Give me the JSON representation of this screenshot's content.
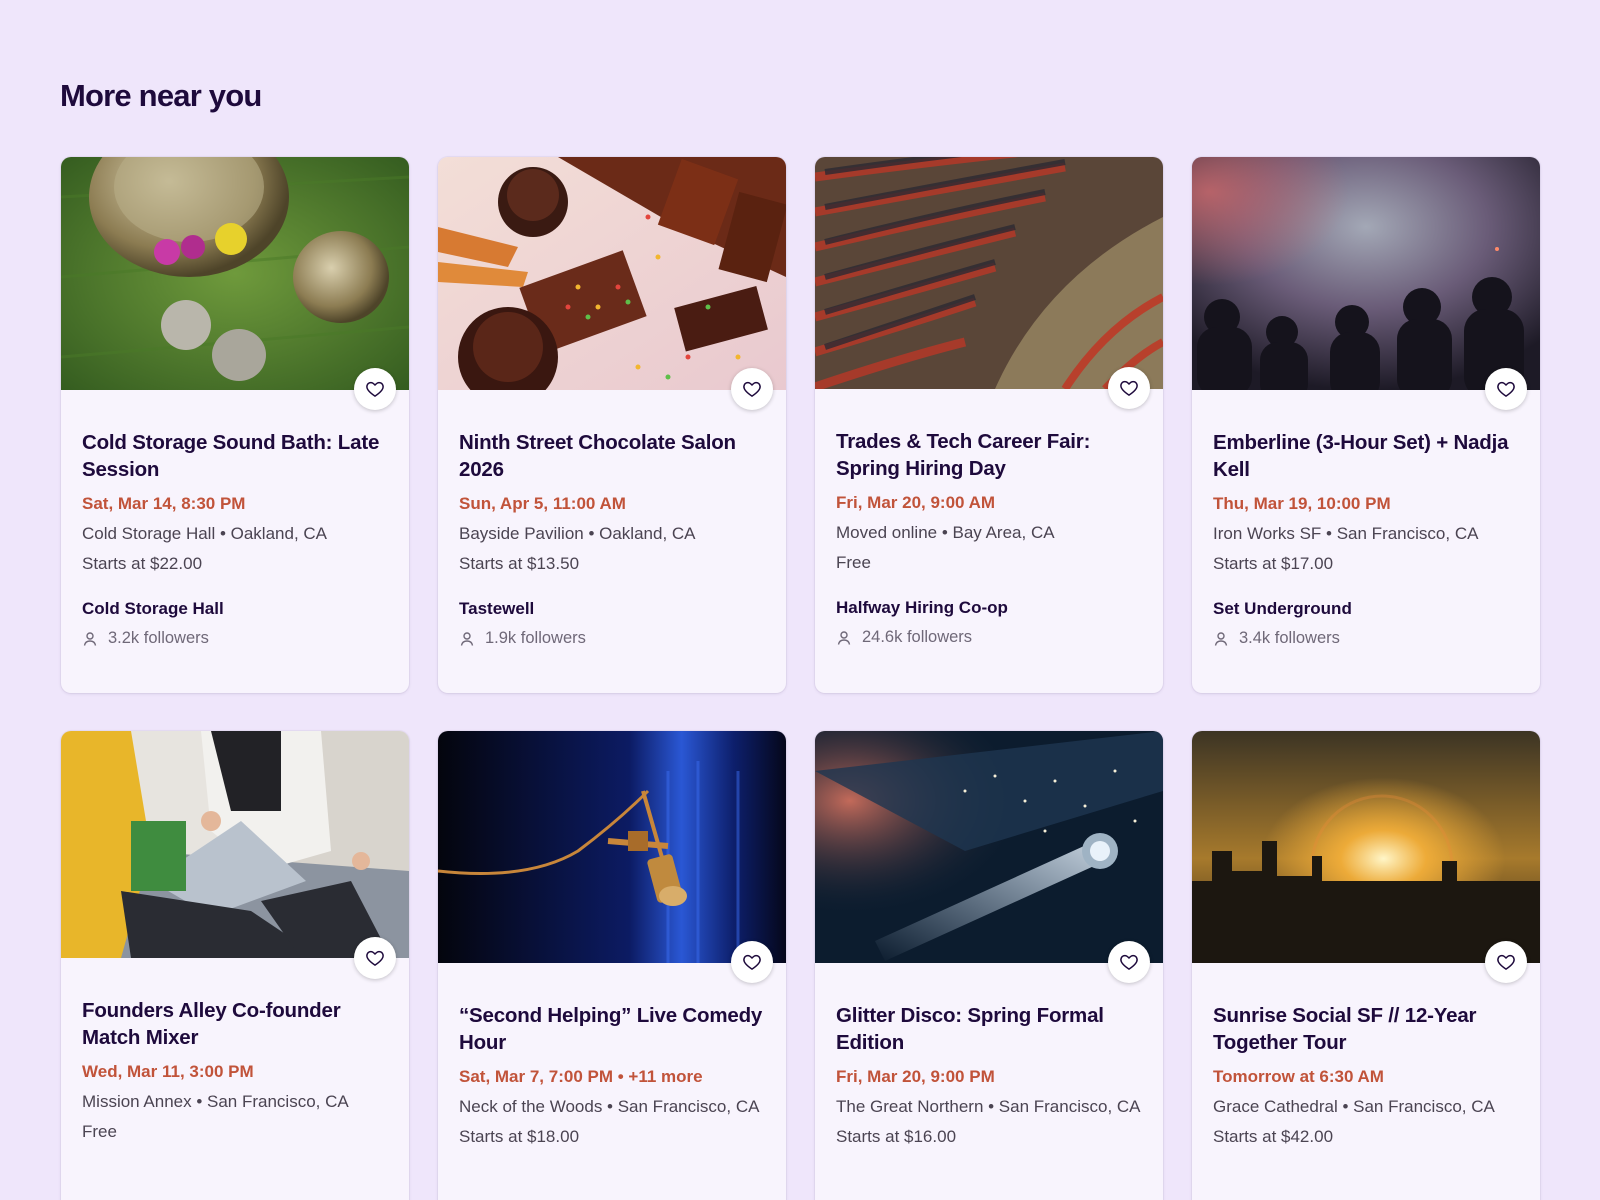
{
  "section": {
    "title": "More near you"
  },
  "events": [
    {
      "title": "Cold Storage Sound Bath: Late Session",
      "date": "Sat, Mar 14, 8:30 PM",
      "location": "Cold Storage Hall • Oakland, CA",
      "price": "Starts at $22.00",
      "organizer": "Cold Storage Hall",
      "followers": "3.2k followers",
      "image": "singing-bowls-on-grass"
    },
    {
      "title": "Ninth Street Chocolate Salon 2026",
      "date": "Sun, Apr 5, 11:00 AM",
      "location": "Bayside Pavilion • Oakland, CA",
      "price": "Starts at $13.50",
      "organizer": "Tastewell",
      "followers": "1.9k followers",
      "image": "chocolates-with-sprinkles"
    },
    {
      "title": "Trades & Tech Career Fair: Spring Hiring Day",
      "date": "Fri, Mar 20, 9:00 AM",
      "location": "Moved online • Bay Area, CA",
      "price": "Free",
      "organizer": "Halfway Hiring Co-op",
      "followers": "24.6k followers",
      "image": "auditorium-audience"
    },
    {
      "title": "Emberline (3-Hour Set) + Nadja Kell",
      "date": "Thu, Mar 19, 10:00 PM",
      "location": "Iron Works SF • San Francisco, CA",
      "price": "Starts at $17.00",
      "organizer": "Set Underground",
      "followers": "3.4k followers",
      "image": "concert-crowd-haze"
    },
    {
      "title": "Founders Alley Co-founder Match Mixer",
      "date": "Wed, Mar 11, 3:00 PM",
      "location": "Mission Annex • San Francisco, CA",
      "price": "Free",
      "image": "people-with-laptop"
    },
    {
      "title": "“Second Helping” Live Comedy Hour",
      "date": "Sat, Mar 7, 7:00 PM • +11 more",
      "location": "Neck of the Woods • San Francisco, CA",
      "price": "Starts at $18.00",
      "image": "microphone-blue-curtain"
    },
    {
      "title": "Glitter Disco: Spring Formal Edition",
      "date": "Fri, Mar 20, 9:00 PM",
      "location": "The Great Northern • San Francisco, CA",
      "price": "Starts at $16.00",
      "image": "disco-ball-spotlight"
    },
    {
      "title": "Sunrise Social SF // 12-Year Together Tour",
      "date": "Tomorrow at 6:30 AM",
      "location": "Grace Cathedral • San Francisco, CA",
      "price": "Starts at $42.00",
      "image": "sunrise-over-city"
    }
  ],
  "icons": {
    "favorite": "heart-icon",
    "followers": "person-icon"
  },
  "colors": {
    "background": "#efe6fb",
    "date_accent": "#c1533a",
    "title": "#1e0a3c"
  }
}
